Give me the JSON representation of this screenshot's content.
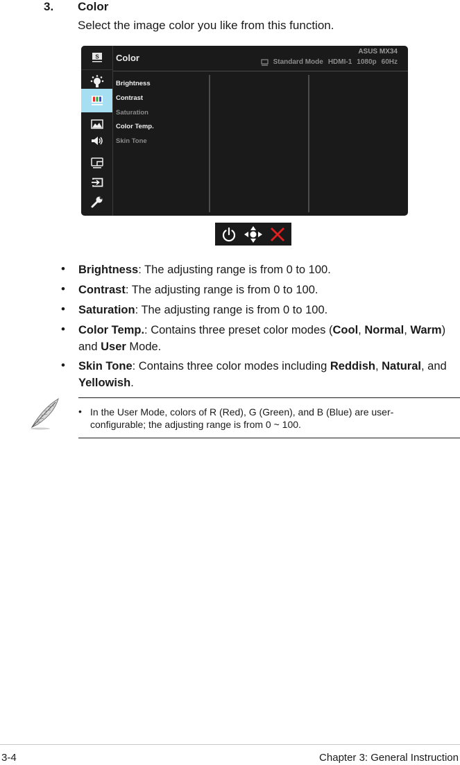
{
  "section": {
    "number": "3.",
    "title": "Color",
    "description": "Select the image color you like from this function."
  },
  "osd": {
    "title": "Color",
    "model": "ASUS  MX34",
    "status": {
      "mode": "Standard Mode",
      "input": "HDMI-1",
      "resolution": "1080p",
      "refresh": "60Hz"
    },
    "sidebar": [
      {
        "icon": "splendid-icon",
        "active": false
      },
      {
        "icon": "blue-light-filter-icon",
        "active": false
      },
      {
        "icon": "color-icon",
        "active": true
      },
      {
        "icon": "image-icon",
        "active": false
      },
      {
        "icon": "sound-icon",
        "active": false
      },
      {
        "icon": "pip-pbp-icon",
        "active": false
      },
      {
        "icon": "input-select-icon",
        "active": false
      },
      {
        "icon": "system-setup-icon",
        "active": false
      }
    ],
    "menu": [
      {
        "label": "Brightness",
        "enabled": true
      },
      {
        "label": "Contrast",
        "enabled": true
      },
      {
        "label": "Saturation",
        "enabled": false
      },
      {
        "label": "Color Temp.",
        "enabled": true
      },
      {
        "label": "Skin Tone",
        "enabled": false
      }
    ],
    "accent_color": "#a6def2"
  },
  "keys": {
    "power": "power-icon",
    "navigate": "five-way-navigation-icon",
    "close": "close-icon",
    "close_color": "#e02020"
  },
  "bullets": [
    {
      "term": "Brightness",
      "text": ": The adjusting range is from 0 to 100."
    },
    {
      "term": "Contrast",
      "text": ": The adjusting range is from 0 to 100."
    },
    {
      "term": "Saturation",
      "text": ": The adjusting range is from 0 to 100."
    },
    {
      "term": "Color Temp.",
      "text_parts": [
        ": Contains three preset color modes (",
        "Cool",
        ", ",
        "Normal",
        ", ",
        "Warm",
        ") and ",
        "User",
        " Mode."
      ]
    },
    {
      "term": "Skin Tone",
      "text_parts": [
        ": Contains three color modes including ",
        "Reddish",
        ", ",
        "Natural",
        ", and ",
        "Yellowish",
        "."
      ]
    }
  ],
  "note": {
    "bullet": "•",
    "text": "In the User Mode, colors of R (Red), G (Green), and B (Blue) are user-configurable; the adjusting range is from 0 ~ 100."
  },
  "footer": {
    "page": "3-4",
    "chapter": "Chapter 3: General Instruction"
  }
}
